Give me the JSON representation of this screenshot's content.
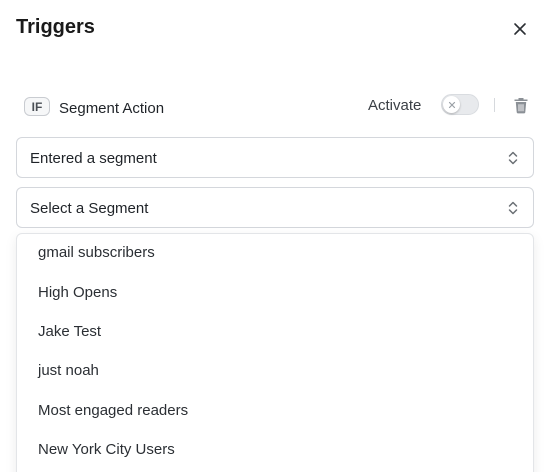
{
  "panel": {
    "title": "Triggers",
    "close_icon": "close-icon"
  },
  "trigger": {
    "badge": "IF",
    "label": "Segment Action",
    "activate_label": "Activate",
    "activated": false,
    "delete_icon": "trash-icon"
  },
  "event_select": {
    "value": "Entered a segment",
    "icon": "chevron-up-down-icon"
  },
  "segment_select": {
    "value": "Select a Segment",
    "icon": "chevron-up-down-icon"
  },
  "segment_options": [
    "gmail subscribers",
    "High Opens",
    "Jake Test",
    "just noah",
    "Most engaged readers",
    "New York City Users"
  ],
  "colors": {
    "text": "#1f2328",
    "border": "#d4d7dc",
    "toggle_off": "#e8eaed"
  }
}
